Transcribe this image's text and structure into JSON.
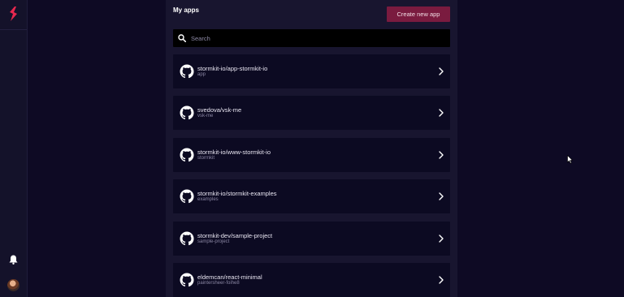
{
  "header": {
    "title": "My apps",
    "create_button": "Create new app"
  },
  "search": {
    "placeholder": "Search"
  },
  "apps": [
    {
      "name": "stormkit-io/app-stormkit-io",
      "sub": "app"
    },
    {
      "name": "svedova/vsk-me",
      "sub": "vsk-me"
    },
    {
      "name": "stormkit-io/www-stormkit-io",
      "sub": "stormkit"
    },
    {
      "name": "stormkit-io/stormkit-examples",
      "sub": "examples"
    },
    {
      "name": "stormkit-dev/sample-project",
      "sub": "sample-project"
    },
    {
      "name": "eldemcan/react-minimal",
      "sub": "paintersheer-foihe8"
    }
  ],
  "colors": {
    "accent": "#7a1b3f",
    "logo": "#e8284f",
    "background": "#0e0a24"
  },
  "icons": {
    "logo": "stormkit-logo",
    "search": "search-icon",
    "repo": "github-icon",
    "open": "chevron-right-icon",
    "notifications": "bell-icon"
  }
}
